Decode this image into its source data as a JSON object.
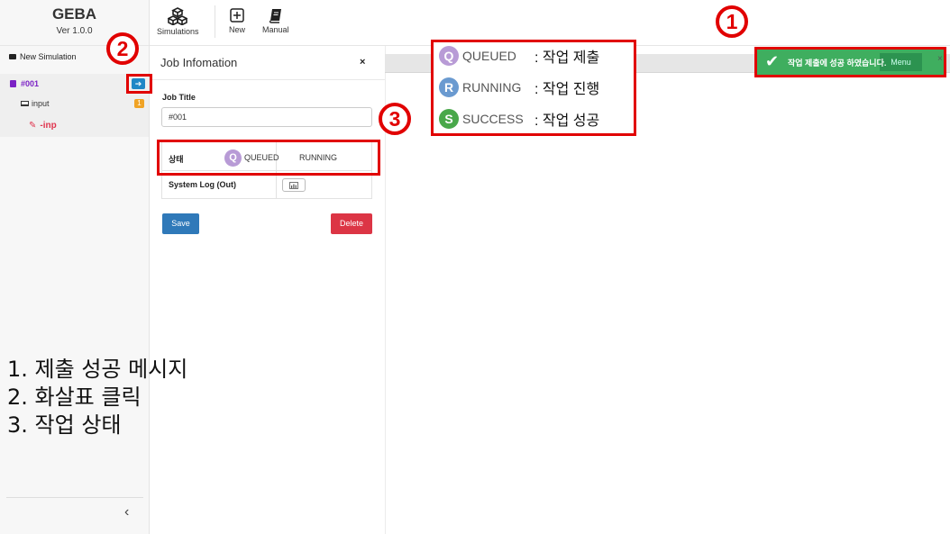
{
  "brand": {
    "name": "GEBA",
    "version": "Ver 1.0.0"
  },
  "toolbar": {
    "simulations": "Simulations",
    "new": "New",
    "manual": "Manual"
  },
  "sidebar": {
    "new_simulation": "New Simulation",
    "job": "#001",
    "arrow": "➔",
    "input": "input",
    "input_badge": "1",
    "inp": "-inp",
    "collapse": "‹"
  },
  "panel": {
    "title": "Job Infomation",
    "close": "×",
    "job_title_label": "Job Title",
    "job_title_value": "#001",
    "status_label": "상태",
    "status_q": "Q",
    "status_queued": "QUEUED",
    "status_running": "RUNNING",
    "log_label": "System Log (Out)",
    "log_icon": "📊",
    "save": "Save",
    "delete": "Delete"
  },
  "legend": {
    "rows": [
      {
        "letter": "Q",
        "state": "QUEUED",
        "desc": ": 작업 제출",
        "color": "#b89bd6"
      },
      {
        "letter": "R",
        "state": "RUNNING",
        "desc": ": 작업 진행",
        "color": "#6a9ad0"
      },
      {
        "letter": "S",
        "state": "SUCCESS",
        "desc": ": 작업 성공",
        "color": "#49a84a"
      }
    ]
  },
  "toast": {
    "check": "✔",
    "message": "작업 제출에 성공 하였습니다.",
    "menu": "Menu",
    "close": "×"
  },
  "markers": {
    "one": "1",
    "two": "2",
    "three": "3"
  },
  "notes": {
    "line1": "1. 제출 성공 메시지",
    "line2": "2. 화살표 클릭",
    "line3": "3. 작업 상태"
  },
  "colors": {
    "accent_red": "#e10000",
    "purple": "#7b22c5",
    "save_blue": "#2f79b9",
    "delete_red": "#dc3545",
    "toast_green": "#3fae5f"
  }
}
